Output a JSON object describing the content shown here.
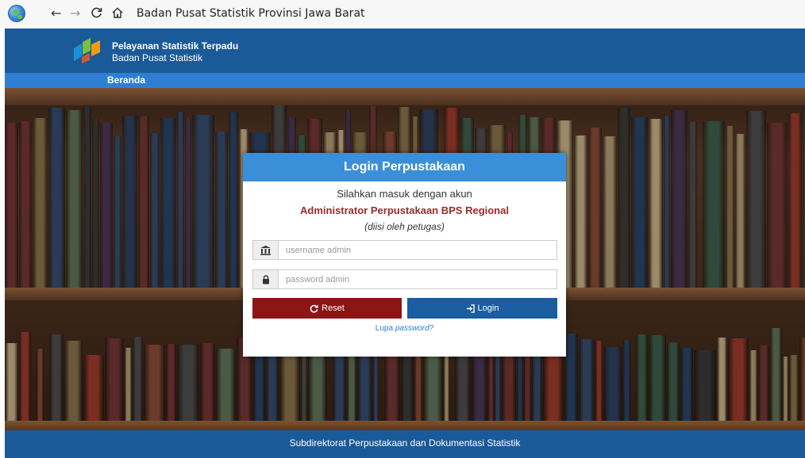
{
  "browser": {
    "title": "Badan Pusat Statistik Provinsi Jawa Barat",
    "back_icon": "←",
    "forward_icon": "→",
    "reload_icon": "C",
    "home_icon": "⌂"
  },
  "header": {
    "brand_line1": "Pelayanan Statistik Terpadu",
    "brand_line2": "Badan Pusat Statistik"
  },
  "nav": {
    "home": "Beranda"
  },
  "login": {
    "title": "Login Perpustakaan",
    "intro": "Silahkan masuk dengan akun",
    "role": "Administrator Perpustakaan BPS Regional",
    "note": "(diisi oleh petugas)",
    "username_placeholder": "username admin",
    "password_placeholder": "password admin",
    "reset_label": "Reset",
    "login_label": "Login",
    "forgot_prefix": "Lupa ",
    "forgot_word": "password?"
  },
  "footer": {
    "text": "Subdirektorat Perpustakaan dan Dokumentasi Statistik"
  },
  "colors": {
    "header": "#1b5a98",
    "nav_strip": "#2e7fd4",
    "card_header": "#3a8fd8",
    "reset": "#8c1515",
    "login": "#1a5da0",
    "role_text": "#9c2a2a"
  }
}
